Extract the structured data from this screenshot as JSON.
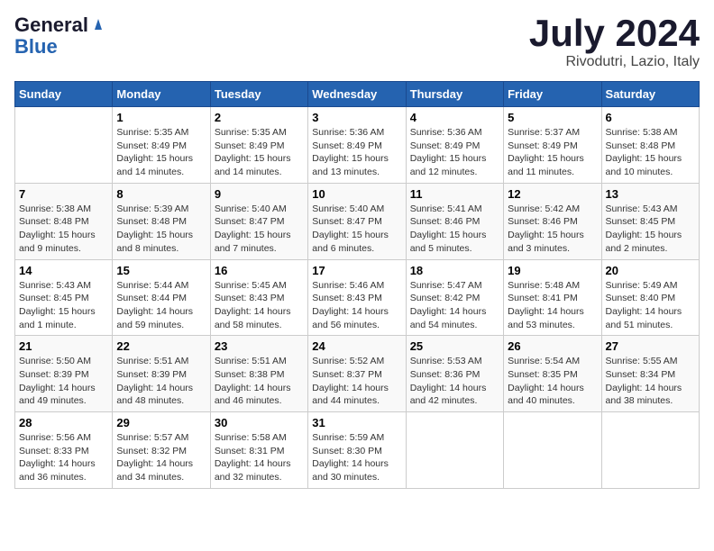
{
  "logo": {
    "general": "General",
    "blue": "Blue"
  },
  "title": {
    "month": "July 2024",
    "location": "Rivodutri, Lazio, Italy"
  },
  "headers": [
    "Sunday",
    "Monday",
    "Tuesday",
    "Wednesday",
    "Thursday",
    "Friday",
    "Saturday"
  ],
  "weeks": [
    [
      {
        "day": "",
        "sunrise": "",
        "sunset": "",
        "daylight": ""
      },
      {
        "day": "1",
        "sunrise": "Sunrise: 5:35 AM",
        "sunset": "Sunset: 8:49 PM",
        "daylight": "Daylight: 15 hours and 14 minutes."
      },
      {
        "day": "2",
        "sunrise": "Sunrise: 5:35 AM",
        "sunset": "Sunset: 8:49 PM",
        "daylight": "Daylight: 15 hours and 14 minutes."
      },
      {
        "day": "3",
        "sunrise": "Sunrise: 5:36 AM",
        "sunset": "Sunset: 8:49 PM",
        "daylight": "Daylight: 15 hours and 13 minutes."
      },
      {
        "day": "4",
        "sunrise": "Sunrise: 5:36 AM",
        "sunset": "Sunset: 8:49 PM",
        "daylight": "Daylight: 15 hours and 12 minutes."
      },
      {
        "day": "5",
        "sunrise": "Sunrise: 5:37 AM",
        "sunset": "Sunset: 8:49 PM",
        "daylight": "Daylight: 15 hours and 11 minutes."
      },
      {
        "day": "6",
        "sunrise": "Sunrise: 5:38 AM",
        "sunset": "Sunset: 8:48 PM",
        "daylight": "Daylight: 15 hours and 10 minutes."
      }
    ],
    [
      {
        "day": "7",
        "sunrise": "Sunrise: 5:38 AM",
        "sunset": "Sunset: 8:48 PM",
        "daylight": "Daylight: 15 hours and 9 minutes."
      },
      {
        "day": "8",
        "sunrise": "Sunrise: 5:39 AM",
        "sunset": "Sunset: 8:48 PM",
        "daylight": "Daylight: 15 hours and 8 minutes."
      },
      {
        "day": "9",
        "sunrise": "Sunrise: 5:40 AM",
        "sunset": "Sunset: 8:47 PM",
        "daylight": "Daylight: 15 hours and 7 minutes."
      },
      {
        "day": "10",
        "sunrise": "Sunrise: 5:40 AM",
        "sunset": "Sunset: 8:47 PM",
        "daylight": "Daylight: 15 hours and 6 minutes."
      },
      {
        "day": "11",
        "sunrise": "Sunrise: 5:41 AM",
        "sunset": "Sunset: 8:46 PM",
        "daylight": "Daylight: 15 hours and 5 minutes."
      },
      {
        "day": "12",
        "sunrise": "Sunrise: 5:42 AM",
        "sunset": "Sunset: 8:46 PM",
        "daylight": "Daylight: 15 hours and 3 minutes."
      },
      {
        "day": "13",
        "sunrise": "Sunrise: 5:43 AM",
        "sunset": "Sunset: 8:45 PM",
        "daylight": "Daylight: 15 hours and 2 minutes."
      }
    ],
    [
      {
        "day": "14",
        "sunrise": "Sunrise: 5:43 AM",
        "sunset": "Sunset: 8:45 PM",
        "daylight": "Daylight: 15 hours and 1 minute."
      },
      {
        "day": "15",
        "sunrise": "Sunrise: 5:44 AM",
        "sunset": "Sunset: 8:44 PM",
        "daylight": "Daylight: 14 hours and 59 minutes."
      },
      {
        "day": "16",
        "sunrise": "Sunrise: 5:45 AM",
        "sunset": "Sunset: 8:43 PM",
        "daylight": "Daylight: 14 hours and 58 minutes."
      },
      {
        "day": "17",
        "sunrise": "Sunrise: 5:46 AM",
        "sunset": "Sunset: 8:43 PM",
        "daylight": "Daylight: 14 hours and 56 minutes."
      },
      {
        "day": "18",
        "sunrise": "Sunrise: 5:47 AM",
        "sunset": "Sunset: 8:42 PM",
        "daylight": "Daylight: 14 hours and 54 minutes."
      },
      {
        "day": "19",
        "sunrise": "Sunrise: 5:48 AM",
        "sunset": "Sunset: 8:41 PM",
        "daylight": "Daylight: 14 hours and 53 minutes."
      },
      {
        "day": "20",
        "sunrise": "Sunrise: 5:49 AM",
        "sunset": "Sunset: 8:40 PM",
        "daylight": "Daylight: 14 hours and 51 minutes."
      }
    ],
    [
      {
        "day": "21",
        "sunrise": "Sunrise: 5:50 AM",
        "sunset": "Sunset: 8:39 PM",
        "daylight": "Daylight: 14 hours and 49 minutes."
      },
      {
        "day": "22",
        "sunrise": "Sunrise: 5:51 AM",
        "sunset": "Sunset: 8:39 PM",
        "daylight": "Daylight: 14 hours and 48 minutes."
      },
      {
        "day": "23",
        "sunrise": "Sunrise: 5:51 AM",
        "sunset": "Sunset: 8:38 PM",
        "daylight": "Daylight: 14 hours and 46 minutes."
      },
      {
        "day": "24",
        "sunrise": "Sunrise: 5:52 AM",
        "sunset": "Sunset: 8:37 PM",
        "daylight": "Daylight: 14 hours and 44 minutes."
      },
      {
        "day": "25",
        "sunrise": "Sunrise: 5:53 AM",
        "sunset": "Sunset: 8:36 PM",
        "daylight": "Daylight: 14 hours and 42 minutes."
      },
      {
        "day": "26",
        "sunrise": "Sunrise: 5:54 AM",
        "sunset": "Sunset: 8:35 PM",
        "daylight": "Daylight: 14 hours and 40 minutes."
      },
      {
        "day": "27",
        "sunrise": "Sunrise: 5:55 AM",
        "sunset": "Sunset: 8:34 PM",
        "daylight": "Daylight: 14 hours and 38 minutes."
      }
    ],
    [
      {
        "day": "28",
        "sunrise": "Sunrise: 5:56 AM",
        "sunset": "Sunset: 8:33 PM",
        "daylight": "Daylight: 14 hours and 36 minutes."
      },
      {
        "day": "29",
        "sunrise": "Sunrise: 5:57 AM",
        "sunset": "Sunset: 8:32 PM",
        "daylight": "Daylight: 14 hours and 34 minutes."
      },
      {
        "day": "30",
        "sunrise": "Sunrise: 5:58 AM",
        "sunset": "Sunset: 8:31 PM",
        "daylight": "Daylight: 14 hours and 32 minutes."
      },
      {
        "day": "31",
        "sunrise": "Sunrise: 5:59 AM",
        "sunset": "Sunset: 8:30 PM",
        "daylight": "Daylight: 14 hours and 30 minutes."
      },
      {
        "day": "",
        "sunrise": "",
        "sunset": "",
        "daylight": ""
      },
      {
        "day": "",
        "sunrise": "",
        "sunset": "",
        "daylight": ""
      },
      {
        "day": "",
        "sunrise": "",
        "sunset": "",
        "daylight": ""
      }
    ]
  ]
}
